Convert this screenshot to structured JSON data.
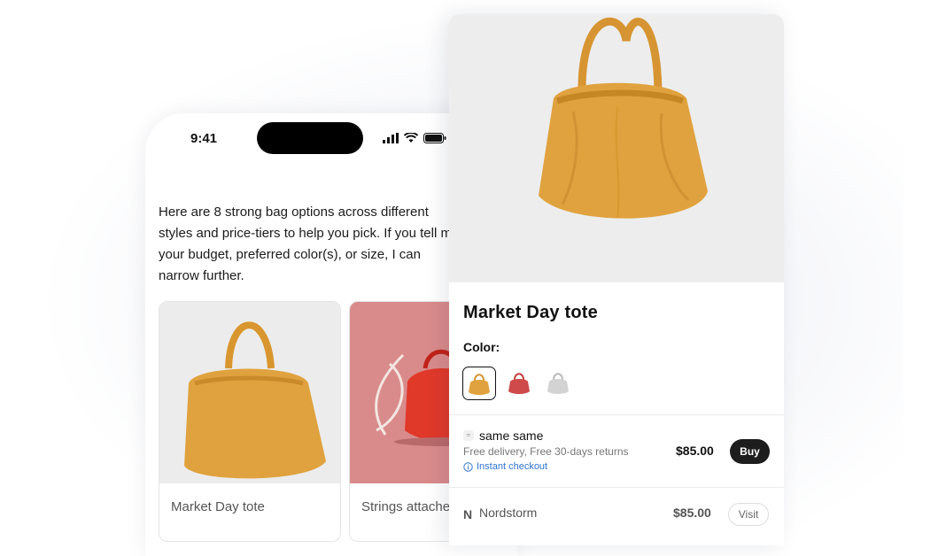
{
  "status_bar": {
    "time": "9:41"
  },
  "chat": {
    "message": "Here are 8 strong bag options across different styles and price-tiers to help you pick. If you tell me your budget, preferred color(s), or size, I can narrow further."
  },
  "cards": [
    {
      "title": "Market Day tote"
    },
    {
      "title": "Strings attached"
    }
  ],
  "product": {
    "title": "Market Day tote",
    "color_label": "Color:",
    "colors": [
      {
        "name": "mustard",
        "hex": "#e0a23e"
      },
      {
        "name": "red",
        "hex": "#cf4a4a"
      },
      {
        "name": "silver",
        "hex": "#cfcfcf"
      }
    ],
    "sellers": [
      {
        "name": "same same",
        "delivery": "Free delivery, Free 30-days returns",
        "badge": "Instant checkout",
        "price": "$85.00",
        "action": "Buy"
      },
      {
        "logo": "N",
        "name": "Nordstorm",
        "price": "$85.00",
        "action": "Visit"
      }
    ]
  },
  "colors": {
    "accent": "#2f74d0",
    "button_dark": "#1d1d1d",
    "bag": "#e0a23e"
  }
}
